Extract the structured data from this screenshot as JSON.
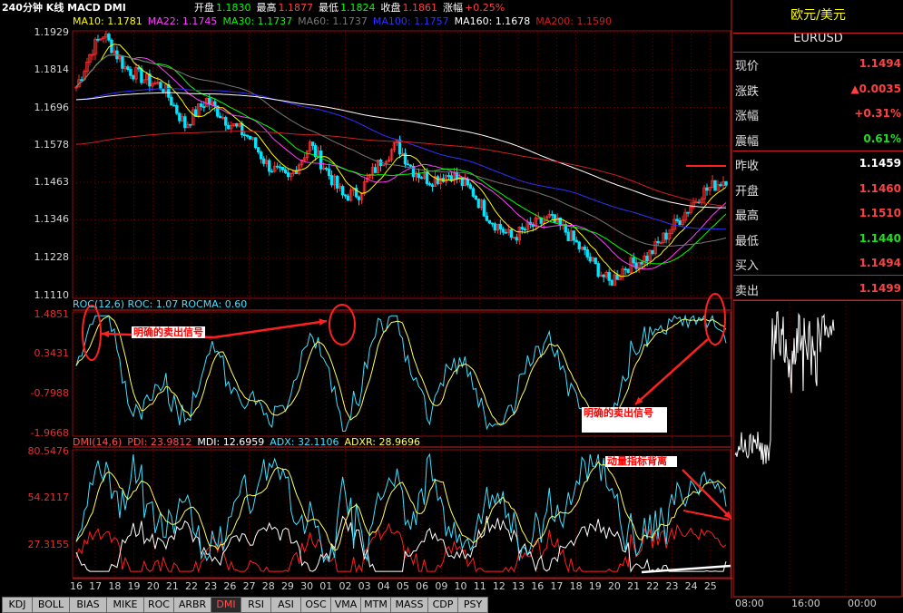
{
  "header": {
    "title": "240分钟 K线 MACD DMI",
    "open_label": "开盘",
    "open": "1.1830",
    "high_label": "最高",
    "high": "1.1877",
    "low_label": "最低",
    "low": "1.1824",
    "close_label": "收盘",
    "close": "1.1861",
    "change_label": "涨幅",
    "change": "+0.25%"
  },
  "ma_legend": [
    {
      "text": "MA10: 1.1781",
      "color": "#ffff00"
    },
    {
      "text": "MA22: 1.1745",
      "color": "#ff40ff"
    },
    {
      "text": "MA30: 1.1737",
      "color": "#00ff00"
    },
    {
      "text": "MA60: 1.1737",
      "color": "#777777"
    },
    {
      "text": "MA100: 1.1757",
      "color": "#3030ff"
    },
    {
      "text": "MA160: 1.1678",
      "color": "#ffffff"
    },
    {
      "text": "MA200: 1.1590",
      "color": "#cc2020"
    }
  ],
  "price_axis": [
    "1.1929",
    "1.1814",
    "1.1696",
    "1.1578",
    "1.1463",
    "1.1346",
    "1.1228",
    "1.1110"
  ],
  "roc_legend": "ROC(12,6) ROC: 1.07 ROCMA: 0.60",
  "roc_axis": [
    "1.4851",
    "0.3431",
    "-0.7988",
    "-1.9668"
  ],
  "dmi_legend": {
    "name": "DMI(14,6)",
    "pdi": "PDI: 23.9812",
    "mdi": "MDI: 12.6959",
    "adx": "ADX: 32.1106",
    "adxr": "ADXR: 28.9696"
  },
  "dmi_axis": [
    "80.5476",
    "54.2117",
    "27.3155"
  ],
  "date_axis": [
    "16",
    "17",
    "18",
    "19",
    "20",
    "21",
    "22",
    "23",
    "26",
    "27",
    "28",
    "29",
    "30",
    "01",
    "02",
    "03",
    "04",
    "05",
    "06",
    "09",
    "10",
    "11",
    "12",
    "13",
    "16",
    "17",
    "18",
    "19",
    "20",
    "21",
    "22",
    "23",
    "24",
    "25"
  ],
  "time_axis": [
    "08:00",
    "16:00",
    "00:00"
  ],
  "annotations": {
    "sell_signal_1": "明确的卖出信号",
    "sell_signal_2": "明确的卖出信号",
    "divergence": "动量指标背离"
  },
  "panel": {
    "title": "欧元/美元",
    "symbol": "EURUSD",
    "rows": [
      {
        "label": "现价",
        "value": "1.1494",
        "color": "red"
      },
      {
        "label": "涨跌",
        "value": "▲0.0035",
        "color": "red"
      },
      {
        "label": "涨幅",
        "value": "+0.31%",
        "color": "red"
      },
      {
        "label": "震幅",
        "value": "0.61%",
        "color": "green"
      },
      {
        "label": "昨收",
        "value": "1.1459",
        "color": "white"
      },
      {
        "label": "开盘",
        "value": "1.1460",
        "color": "red"
      },
      {
        "label": "最高",
        "value": "1.1510",
        "color": "red"
      },
      {
        "label": "最低",
        "value": "1.1440",
        "color": "green"
      },
      {
        "label": "买入",
        "value": "1.1494",
        "color": "red"
      },
      {
        "label": "卖出",
        "value": "1.1499",
        "color": "red"
      }
    ]
  },
  "tabs": [
    "KDJ",
    "BOLL",
    "BIAS",
    "MIKE",
    "ROC",
    "ARBR",
    "DMI",
    "RSI",
    "ASI",
    "OSC",
    "VMA",
    "MTM",
    "MASS",
    "CDP",
    "PSY"
  ],
  "active_tab": "DMI",
  "colors": {
    "bull": "#ff3030",
    "bear": "#00e5ff",
    "roc": "#40e0ff",
    "rocma": "#ffff60",
    "pdi": "#ff2020",
    "mdi": "#ffffff",
    "adx": "#40e0ff",
    "adxr": "#ffff60",
    "grid": "#8a1010"
  }
}
